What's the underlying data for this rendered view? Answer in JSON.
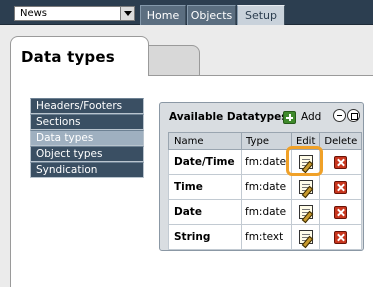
{
  "site_select": {
    "value": "News"
  },
  "nav": [
    {
      "label": "Home"
    },
    {
      "label": "Objects"
    },
    {
      "label": "Setup"
    }
  ],
  "page_title": "Data types",
  "left_menu": [
    {
      "label": "Headers/Footers"
    },
    {
      "label": "Sections"
    },
    {
      "label": "Data types"
    },
    {
      "label": "Object types"
    },
    {
      "label": "Syndication"
    }
  ],
  "panel": {
    "title": "Available Datatypes",
    "add_label": "Add",
    "columns": [
      "Name",
      "Type",
      "Edit",
      "Delete"
    ],
    "rows": [
      {
        "name": "Date/Time",
        "type": "fm:date"
      },
      {
        "name": "Time",
        "type": "fm:date"
      },
      {
        "name": "Date",
        "type": "fm:date"
      },
      {
        "name": "String",
        "type": "fm:text"
      }
    ]
  },
  "colors": {
    "topbar": "#2c3e50",
    "highlight": "#f0a128",
    "delete": "#c8361e",
    "add": "#3f8a2c"
  }
}
